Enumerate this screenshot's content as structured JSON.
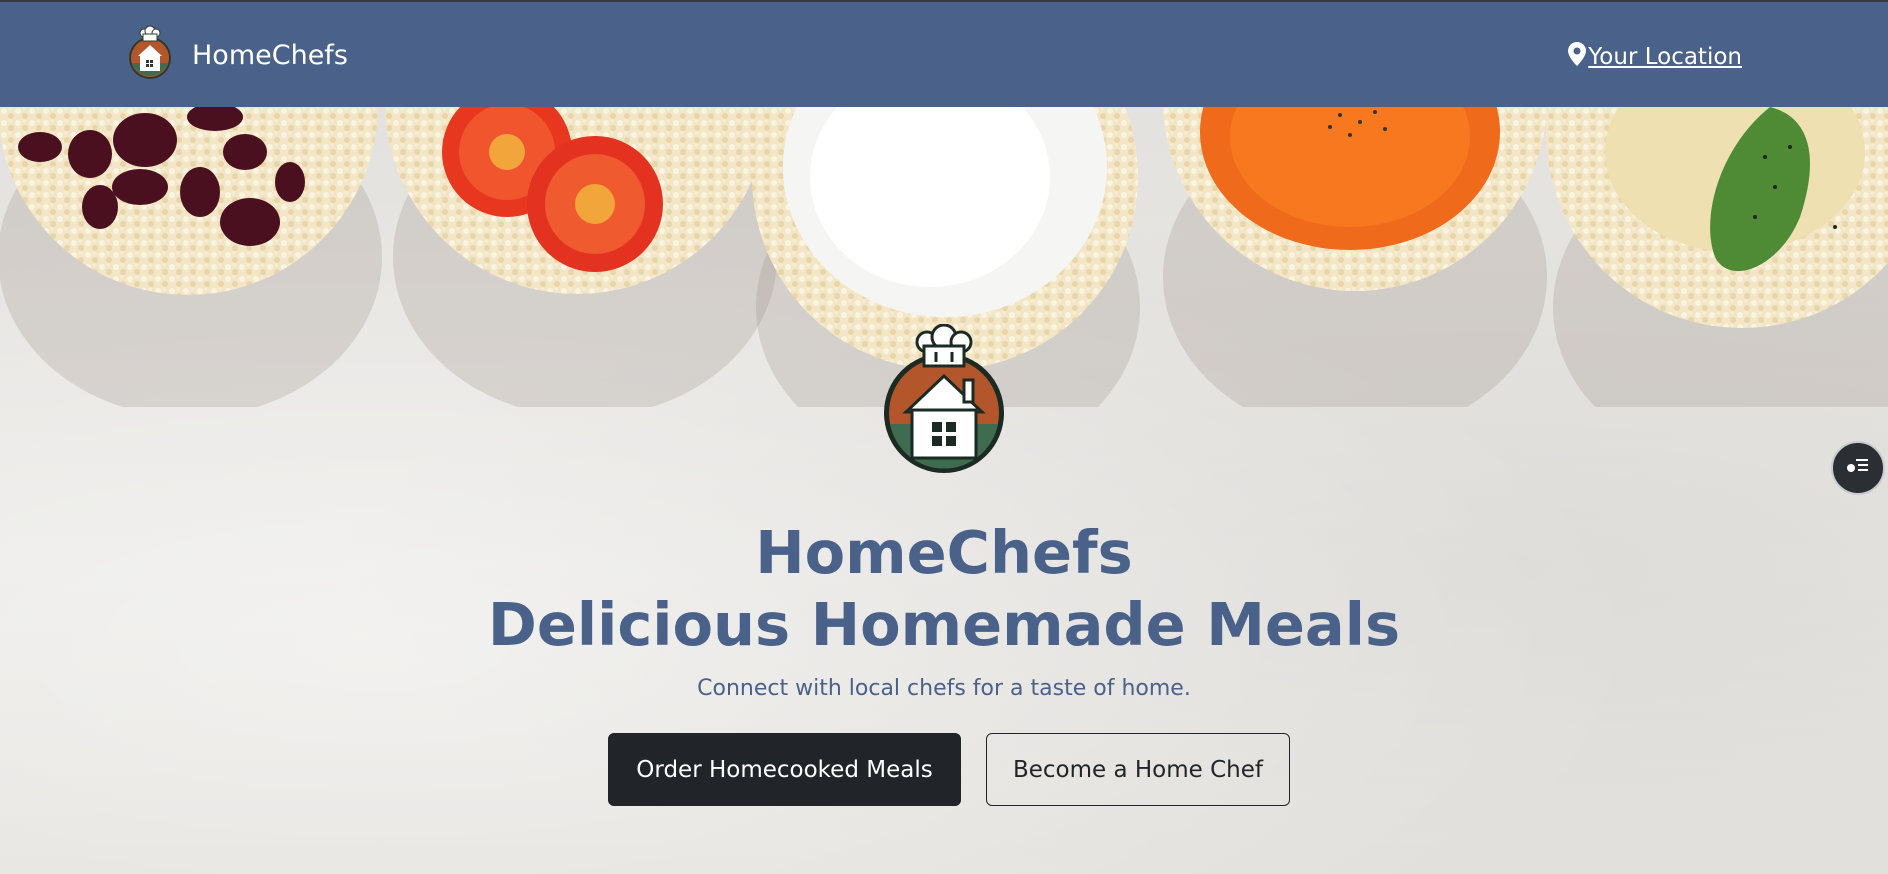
{
  "navbar": {
    "brand_name": "HomeChefs",
    "location_label": "Your Location",
    "icons": {
      "logo": "homechefs-logo-icon",
      "location": "map-pin-icon"
    }
  },
  "hero": {
    "title_line1": "HomeChefs",
    "title_line2": "Delicious Homemade Meals",
    "subtitle": "Connect with local chefs for a taste of home.",
    "primary_button": "Order Homecooked Meals",
    "secondary_button": "Become a Home Chef",
    "background_image": "rice-cakes-with-toppings",
    "icons": {
      "logo": "homechefs-logo-icon",
      "side_button": "user-list-icon"
    }
  },
  "colors": {
    "brand_blue": "#4a6189",
    "dark_button": "#212529",
    "logo_brown": "#b4562b",
    "logo_green": "#3f6b50"
  }
}
